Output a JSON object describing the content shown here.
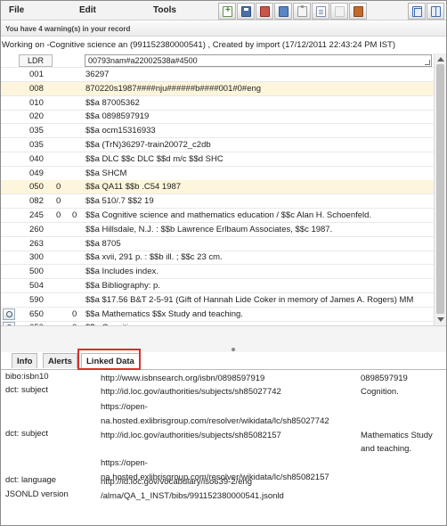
{
  "menu": {
    "file": "File",
    "edit": "Edit",
    "tools": "Tools"
  },
  "toolbar": {
    "icons": [
      "add-record-icon",
      "save-icon",
      "save-release-icon",
      "record-icon",
      "clipboard-icon",
      "copy-icon",
      "page-icon",
      "briefcase-icon",
      "fullscreen-icon",
      "split-view-icon"
    ]
  },
  "warning": "You have 4 warning(s) in your record",
  "working": "Working on -Cognitive science an (991152380000541) , Created by import (17/12/2011 22:43:24 PM IST)",
  "ldr": {
    "label": "LDR",
    "value": "00793nam#a22002538a#4500"
  },
  "fields": [
    {
      "tag": "001",
      "i1": "",
      "i2": "",
      "value": "36297",
      "hl": false,
      "lookup": false
    },
    {
      "tag": "008",
      "i1": "",
      "i2": "",
      "value": "870220s1987####nju######b####001#0#eng",
      "hl": true,
      "lookup": false
    },
    {
      "tag": "010",
      "i1": "",
      "i2": "",
      "value": "$$a 87005362",
      "hl": false,
      "lookup": false
    },
    {
      "tag": "020",
      "i1": "",
      "i2": "",
      "value": "$$a 0898597919",
      "hl": false,
      "lookup": false
    },
    {
      "tag": "035",
      "i1": "",
      "i2": "",
      "value": "$$a ocm15316933",
      "hl": false,
      "lookup": false
    },
    {
      "tag": "035",
      "i1": "",
      "i2": "",
      "value": "$$a (TrN)36297-train20072_c2db",
      "hl": false,
      "lookup": false
    },
    {
      "tag": "040",
      "i1": "",
      "i2": "",
      "value": "$$a DLC $$c DLC $$d m/c $$d SHC",
      "hl": false,
      "lookup": false
    },
    {
      "tag": "049",
      "i1": "",
      "i2": "",
      "value": "$$a SHCM",
      "hl": false,
      "lookup": false
    },
    {
      "tag": "050",
      "i1": "0",
      "i2": "",
      "value": "$$a QA11 $$b .C54 1987",
      "hl": true,
      "lookup": false
    },
    {
      "tag": "082",
      "i1": "0",
      "i2": "",
      "value": "$$a 510/.7 $$2 19",
      "hl": false,
      "lookup": false
    },
    {
      "tag": "245",
      "i1": "0",
      "i2": "0",
      "value": "$$a Cognitive science and mathematics education / $$c Alan H. Schoenfeld.",
      "hl": false,
      "lookup": false
    },
    {
      "tag": "260",
      "i1": "",
      "i2": "",
      "value": "$$a Hillsdale, N.J. : $$b Lawrence Erlbaum Associates, $$c 1987.",
      "hl": false,
      "lookup": false
    },
    {
      "tag": "263",
      "i1": "",
      "i2": "",
      "value": "$$a 8705",
      "hl": false,
      "lookup": false
    },
    {
      "tag": "300",
      "i1": "",
      "i2": "",
      "value": "$$a xvii, 291 p. : $$b ill. ; $$c 23 cm.",
      "hl": false,
      "lookup": false
    },
    {
      "tag": "500",
      "i1": "",
      "i2": "",
      "value": "$$a Includes index.",
      "hl": false,
      "lookup": false
    },
    {
      "tag": "504",
      "i1": "",
      "i2": "",
      "value": "$$a Bibliography: p.",
      "hl": false,
      "lookup": false
    },
    {
      "tag": "590",
      "i1": "",
      "i2": "",
      "value": "$$a $17.56 B&T 2-5-91 (Gift of Hannah Lide Coker in memory of James A. Rogers) MM",
      "hl": false,
      "lookup": false
    },
    {
      "tag": "650",
      "i1": "",
      "i2": "0",
      "value": "$$a Mathematics $$x Study and teaching.",
      "hl": false,
      "lookup": true
    },
    {
      "tag": "650",
      "i1": "",
      "i2": "0",
      "value": "$$a Cognition.",
      "hl": false,
      "lookup": true
    }
  ],
  "tabs": [
    "Info",
    "Alerts",
    "Linked Data"
  ],
  "linked_data": [
    {
      "key": "bibo:isbn10",
      "uri": "http://www.isbnsearch.org/isbn/0898597919",
      "value": "0898597919"
    },
    {
      "key": "dct: subject",
      "uri": "http://id.loc.gov/authorities/subjects/sh85027742",
      "value": "Cognition."
    },
    {
      "key": "",
      "uri": "https://open-na.hosted.exlibrisgroup.com/resolver/wikidata/lc/sh85027742",
      "value": ""
    },
    {
      "key": "dct: subject",
      "uri": "http://id.loc.gov/authorities/subjects/sh85082157",
      "value": "Mathematics Study and teaching."
    },
    {
      "key": "",
      "uri": "https://open-na.hosted.exlibrisgroup.com/resolver/wikidata/lc/sh85082157",
      "value": ""
    },
    {
      "key": "dct: language",
      "uri": "http://id.loc.gov/vocabulary/iso639-2/eng",
      "value": ""
    },
    {
      "key": "JSONLD version",
      "uri": "/alma/QA_1_INST/bibs/991152380000541.jsonld",
      "value": ""
    }
  ]
}
